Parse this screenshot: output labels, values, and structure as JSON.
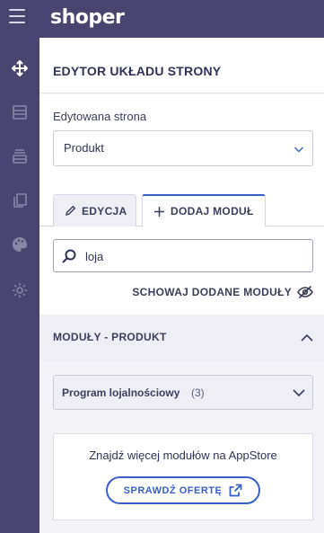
{
  "app": {
    "logo": "shoper"
  },
  "sidebar": {
    "items": [
      {
        "icon": "move-icon"
      },
      {
        "icon": "layout-icon"
      },
      {
        "icon": "stack-icon"
      },
      {
        "icon": "copy-icon"
      },
      {
        "icon": "palette-icon"
      },
      {
        "icon": "gear-icon"
      }
    ]
  },
  "panel": {
    "title": "EDYTOR UKŁADU STRONY",
    "page_label": "Edytowana strona",
    "page_value": "Produkt",
    "tabs": [
      {
        "label": "EDYCJA",
        "icon": "pencil-icon",
        "active": false
      },
      {
        "label": "DODAJ MODUŁ",
        "icon": "plus-icon",
        "active": true
      }
    ],
    "search": {
      "value": "loja",
      "placeholder": ""
    },
    "hide_added": "SCHOWAJ DODANE MODUŁY",
    "section": {
      "title": "MODUŁY - PRODUKT",
      "group": {
        "name": "Program lojalnościowy",
        "count": "(3)"
      }
    },
    "appstore": {
      "text": "Znajdź więcej modułów na AppStore",
      "button": "SPRAWDŹ OFERTĘ"
    }
  },
  "colors": {
    "sidebar_bg": "#4a4570",
    "accent": "#3a5fc8",
    "section_bg": "#eeeef4"
  }
}
